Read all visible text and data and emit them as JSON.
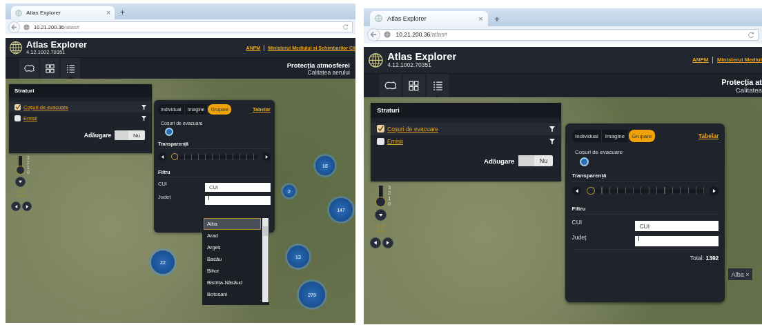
{
  "screens": [
    {
      "tab": {
        "title": "Atlas Explorer",
        "close": "×"
      },
      "new_tab": "+",
      "url": {
        "host": "10.21.200.36",
        "path": "/atlas#"
      },
      "app": {
        "title": "Atlas Explorer",
        "version": "4.12.1002.70351"
      },
      "links": [
        "ANPM",
        "Ministerul Mediului si Schimbarilor Cli"
      ],
      "toolbar": [
        {
          "kind": "outline",
          "selected": false
        },
        {
          "kind": "grid",
          "selected": false
        },
        {
          "kind": "list",
          "selected": true
        }
      ],
      "context": {
        "title": "Protecția atmosferei",
        "subtitle": "Calitatea aerului"
      },
      "zoom": {
        "labels": [
          "3",
          "2",
          "1",
          "0"
        ],
        "level": 0
      },
      "layers": {
        "title": "Straturi",
        "items": [
          {
            "label": "Coșuri de evacuare",
            "checked": true
          },
          {
            "label": "Emisii",
            "checked": false
          }
        ],
        "add_label": "Adăugare",
        "toggle": {
          "label": "Nu",
          "on": false
        }
      },
      "settings": {
        "tabs": [
          {
            "label": "Individual",
            "selected": false
          },
          {
            "label": "Imagine",
            "selected": false
          },
          {
            "label": "Grupare",
            "selected": true
          }
        ],
        "link": "Tabelar",
        "legend": "Coșuri de evacuare",
        "transparency": {
          "label": "Transparență",
          "level": 0
        },
        "filter": {
          "title": "Filtru",
          "fields": [
            {
              "label": "CUI",
              "placeholder": "CUI"
            },
            {
              "label": "Județ",
              "focused": true
            }
          ]
        }
      },
      "dropdown": [
        {
          "label": "Alba",
          "selected": true
        },
        {
          "label": "Arad",
          "selected": false
        },
        {
          "label": "Argeș",
          "selected": false
        },
        {
          "label": "Bacău",
          "selected": false
        },
        {
          "label": "Bihor",
          "selected": false
        },
        {
          "label": "Bistrița-Năsăud",
          "selected": false
        },
        {
          "label": "Botoșani",
          "selected": false
        }
      ],
      "clusters": [
        {
          "count": "18"
        },
        {
          "count": "2"
        },
        {
          "count": "147"
        },
        {
          "count": "22"
        },
        {
          "count": "13"
        },
        {
          "count": "279"
        }
      ]
    },
    {
      "tab": {
        "title": "Atlas Explorer",
        "close": "×"
      },
      "new_tab": "+",
      "url": {
        "host": "10.21.200.36",
        "path": "/atlas#"
      },
      "app": {
        "title": "Atlas Explorer",
        "version": "4.12.1002.70351"
      },
      "links": [
        "ANPM",
        "Ministerul Mediul"
      ],
      "toolbar": [
        {
          "kind": "outline",
          "selected": false
        },
        {
          "kind": "grid",
          "selected": false
        },
        {
          "kind": "list",
          "selected": true
        }
      ],
      "context": {
        "title": "Protecția at",
        "subtitle": "Calitatea"
      },
      "zoom": {
        "labels": [
          "3",
          "2",
          "1",
          "0"
        ],
        "level": 0
      },
      "layers": {
        "title": "Straturi",
        "items": [
          {
            "label": "Coșuri de evacuare",
            "checked": true
          },
          {
            "label": "Emisii",
            "checked": false
          }
        ],
        "add_label": "Adăugare",
        "toggle": {
          "label": "Nu",
          "on": false
        }
      },
      "settings": {
        "tabs": [
          {
            "label": "Individual",
            "selected": false
          },
          {
            "label": "Imagine",
            "selected": false
          },
          {
            "label": "Grupare",
            "selected": true
          }
        ],
        "link": "Tabelar",
        "legend": "Coșuri de evacuare",
        "transparency": {
          "label": "Transparență",
          "level": 0
        },
        "filter": {
          "title": "Filtru",
          "fields": [
            {
              "label": "CUI",
              "placeholder": "CUI"
            },
            {
              "label": "Județ",
              "focused": true
            }
          ]
        },
        "total": {
          "label": "Total:",
          "value": "1392"
        }
      },
      "chip": {
        "label": "Alba",
        "close": "×"
      }
    }
  ]
}
